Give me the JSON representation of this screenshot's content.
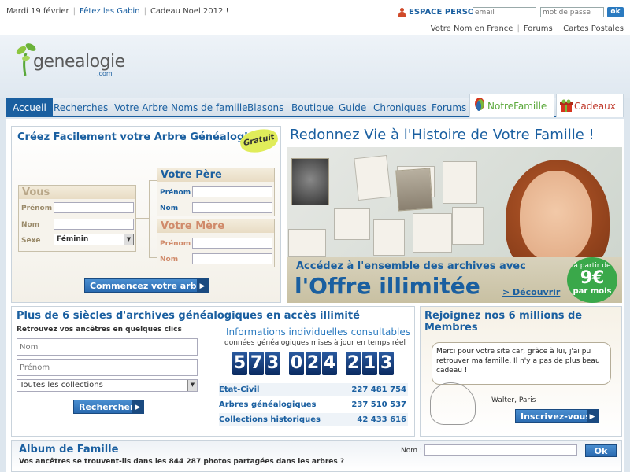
{
  "topbar": {
    "date": "Mardi 19 février",
    "fete": "Fêtez les Gabin",
    "cadeau": "Cadeau Noel 2012 !",
    "espace_perso": "ESPACE PERSO",
    "email_placeholder": "email",
    "password_placeholder": "mot de passe",
    "ok_label": "ok",
    "links": [
      "Votre Nom en France",
      "Forums",
      "Cartes Postales"
    ]
  },
  "logo": {
    "word": "genealogie",
    "suffix": ".com"
  },
  "nav": {
    "items": [
      "Accueil",
      "Recherches",
      "Votre Arbre",
      "Noms de famille",
      "Blasons",
      "Boutique",
      "Guide",
      "Chroniques",
      "Forums"
    ],
    "notre_famille": "NotreFamille",
    "cadeaux": "Cadeaux"
  },
  "arbre": {
    "title": "Créez Facilement votre Arbre Généalogique",
    "badge": "Gratuit",
    "vous": "Vous",
    "pere": "Votre Père",
    "mere": "Votre Mère",
    "prenom": "Prénom",
    "nom": "Nom",
    "sexe": "Sexe",
    "sexe_value": "Féminin",
    "button": "Commencez votre arbre"
  },
  "promo": {
    "title": "Redonnez Vie à l'Histoire de Votre Famille !",
    "line1": "Accédez à l'ensemble des archives avec",
    "line2": "l'Offre illimitée",
    "link": "> Découvrir",
    "price_top": "à partir de",
    "price": "9€",
    "price_unit": "par mois"
  },
  "archives": {
    "title": "Plus de 6 siècles d'archives généalogiques en accès illimité",
    "subtitle": "Retrouvez vos ancêtres en quelques clics",
    "nom_placeholder": "Nom",
    "prenom_placeholder": "Prénom",
    "collections": "Toutes les collections",
    "button": "Rechercher",
    "counter_title": "Informations individuelles consultables",
    "counter_sub": "données généalogiques mises à jour en temps réel",
    "digits": [
      "5",
      "7",
      "3",
      "0",
      "2",
      "4",
      "2",
      "1",
      "3"
    ],
    "stats": [
      {
        "label": "Etat-Civil",
        "value": "227 481 754"
      },
      {
        "label": "Arbres généalogiques",
        "value": "237 510 537"
      },
      {
        "label": "Collections historiques",
        "value": "42 433 616"
      }
    ]
  },
  "membres": {
    "title": "Rejoignez nos 6 millions de Membres",
    "quote": "Merci pour votre site car, grâce à lui, j'ai pu retrouver ma famille. Il n'y a pas de plus beau cadeau !",
    "author": "Walter, Paris",
    "button": "Inscrivez-vous"
  },
  "album": {
    "title": "Album de Famille",
    "subtitle": "Vos ancêtres se trouvent-ils dans les 844 287 photos partagées dans les arbres ?",
    "nom_label": "Nom :",
    "ok_label": "Ok"
  },
  "colors": {
    "brand_blue": "#1a5fa0",
    "accent_green": "#3aa84a",
    "beige": "#b9a789"
  }
}
